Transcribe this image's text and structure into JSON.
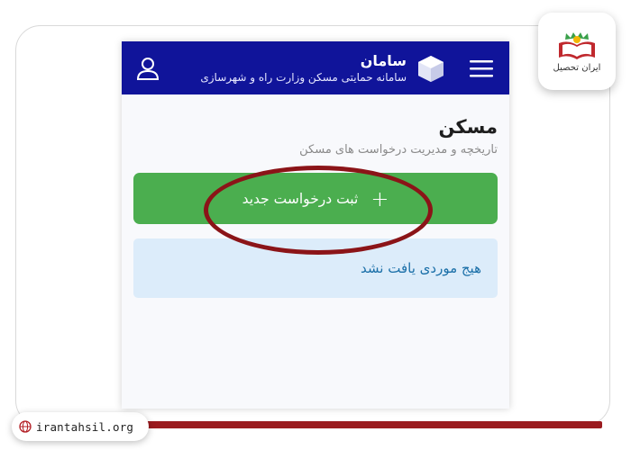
{
  "appbar": {
    "title": "سامان",
    "subtitle": "سامانه حمایتی مسکن وزارت راه و شهرسازی",
    "menu_icon": "hamburger-menu-icon",
    "user_icon": "user-icon",
    "brand_icon": "box-icon",
    "color": "#10149a"
  },
  "page": {
    "title": "مسکن",
    "subtitle": "تاریخچه و مدیریت درخواست های مسکن"
  },
  "actions": {
    "new_request_label": "ثبت درخواست جدید",
    "new_request_icon": "plus-icon",
    "button_color": "#4bae4f"
  },
  "alert": {
    "empty_text": "هیج موردی یافت نشد",
    "background": "#dcecfa"
  },
  "watermark": {
    "logo_text": "ایران تحصیل",
    "site_url": "irantahsil.org",
    "highlight_color": "#8b1418"
  }
}
